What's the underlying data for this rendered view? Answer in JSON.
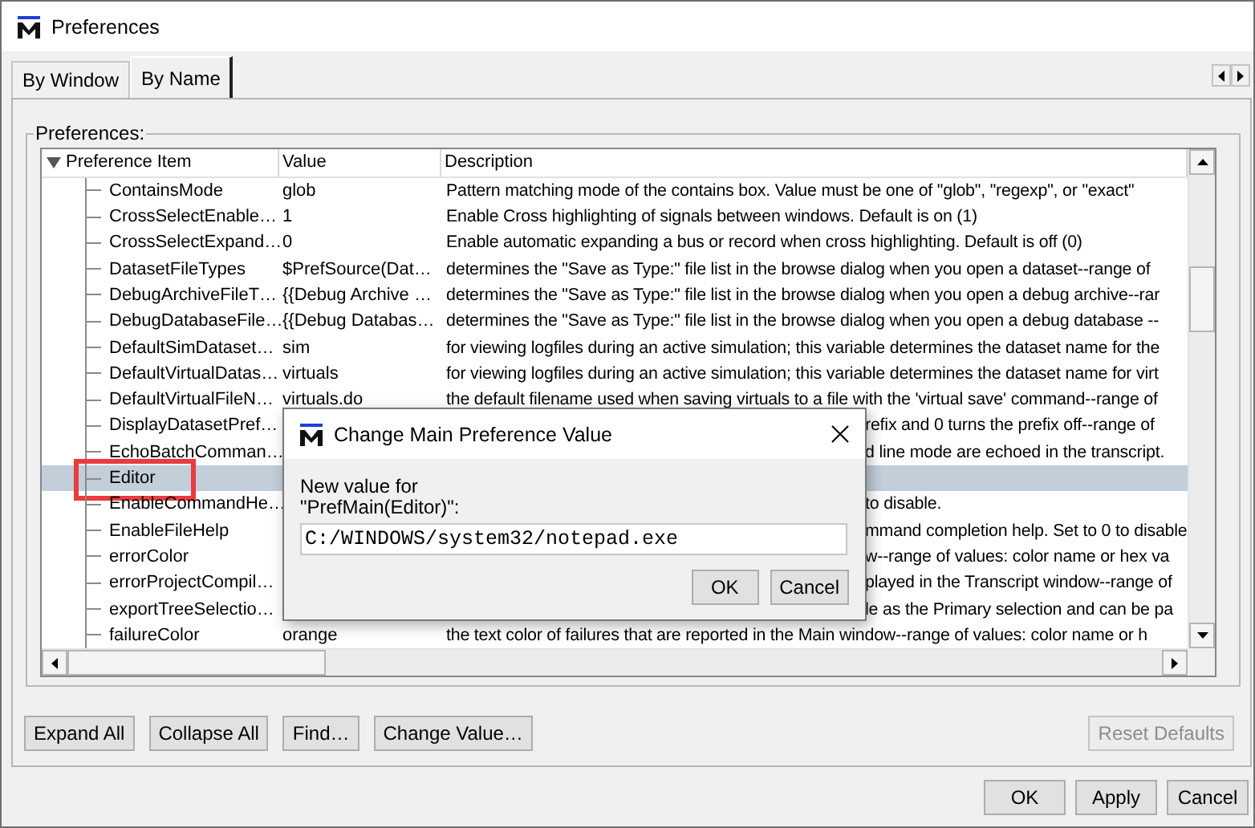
{
  "window": {
    "title": "Preferences"
  },
  "tabs": [
    {
      "label": "By Window",
      "selected": false
    },
    {
      "label": "By Name",
      "selected": true
    }
  ],
  "group": {
    "label": "Preferences:"
  },
  "table": {
    "columns": [
      "Preference Item",
      "Value",
      "Description"
    ],
    "rows": [
      {
        "item": "ContainsMode",
        "value": "glob",
        "description": "Pattern matching mode of the contains box. Value must be one of \"glob\", \"regexp\", or \"exact\"",
        "covered": false,
        "selected": false,
        "marked": false
      },
      {
        "item": "CrossSelectEnable…",
        "value": "1",
        "description": "Enable Cross highlighting of signals between windows. Default is on (1)",
        "covered": false,
        "selected": false,
        "marked": false
      },
      {
        "item": "CrossSelectExpand…",
        "value": "0",
        "description": "Enable automatic expanding a bus or record when cross highlighting. Default is off (0)",
        "covered": false,
        "selected": false,
        "marked": false
      },
      {
        "item": "DatasetFileTypes",
        "value": "$PrefSource(Dat…",
        "description": "determines the \"Save as Type:\" file list in the browse dialog when you open a dataset--range of",
        "covered": false,
        "selected": false,
        "marked": false
      },
      {
        "item": "DebugArchiveFileT…",
        "value": "{{Debug Archive …",
        "description": "determines the \"Save as Type:\" file list in the browse dialog when you open a debug archive--rar",
        "covered": false,
        "selected": false,
        "marked": false
      },
      {
        "item": "DebugDatabaseFile…",
        "value": "{{Debug Databas…",
        "description": "determines the \"Save as Type:\" file list in the browse dialog when you open a debug database --",
        "covered": false,
        "selected": false,
        "marked": false
      },
      {
        "item": "DefaultSimDataset…",
        "value": "sim",
        "description": "for viewing logfiles during an active simulation; this variable determines the dataset name for the",
        "covered": false,
        "selected": false,
        "marked": false
      },
      {
        "item": "DefaultVirtualDatas…",
        "value": "virtuals",
        "description": "for viewing logfiles during an active simulation; this variable determines the dataset name for virt",
        "covered": false,
        "selected": false,
        "marked": false
      },
      {
        "item": "DefaultVirtualFileN…",
        "value": "virtuals.do",
        "description": "the default filename used when saving virtuals to a file with the 'virtual save' command--range of",
        "covered": false,
        "selected": false,
        "marked": false
      },
      {
        "item": "DisplayDatasetPref…",
        "description": "refix and 0 turns the prefix off--range of",
        "covered": true,
        "selected": false,
        "marked": false
      },
      {
        "item": "EchoBatchComman…",
        "description": "d line mode are echoed in the transcript.",
        "covered": true,
        "selected": false,
        "marked": false
      },
      {
        "item": "Editor",
        "covered": true,
        "selected": true,
        "marked": true
      },
      {
        "item": "EnableCommandHe…",
        "description": "to disable.",
        "covered": true,
        "selected": false,
        "marked": false
      },
      {
        "item": "EnableFileHelp",
        "description": "mmand completion help. Set to 0 to disable",
        "covered": true,
        "selected": false,
        "marked": false
      },
      {
        "item": "errorColor",
        "description": "w--range of values: color name or hex va",
        "covered": true,
        "selected": false,
        "marked": false
      },
      {
        "item": "errorProjectCompil…",
        "description": "played in the Transcript window--range of",
        "covered": true,
        "selected": false,
        "marked": false
      },
      {
        "item": "exportTreeSelectio…",
        "description": "le as the Primary selection and can be pa",
        "covered": true,
        "selected": false,
        "marked": false
      },
      {
        "item": "failureColor",
        "value": "orange",
        "description": "the text color of failures that are reported in the Main window--range of values: color name or h",
        "covered": false,
        "selected": false,
        "marked": false
      }
    ]
  },
  "actions": [
    {
      "label": "Expand All",
      "disabled": false
    },
    {
      "label": "Collapse All",
      "disabled": false
    },
    {
      "label": "Find…",
      "disabled": false
    },
    {
      "label": "Change Value…",
      "disabled": false
    },
    {
      "label": "Reset Defaults",
      "disabled": true
    }
  ],
  "footer_buttons": [
    "OK",
    "Apply",
    "Cancel"
  ],
  "dialog": {
    "title": "Change Main Preference Value",
    "prompt": "New value for",
    "target": "\"PrefMain(Editor)\":",
    "value": "C:/WINDOWS/system32/notepad.exe",
    "buttons": [
      "OK",
      "Cancel"
    ]
  }
}
